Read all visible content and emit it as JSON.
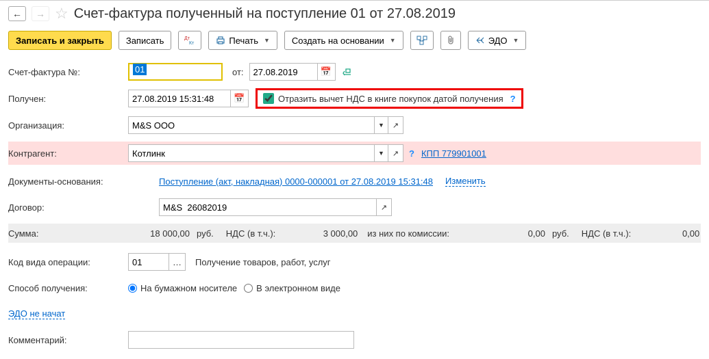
{
  "title": "Счет-фактура полученный на поступление 01 от 27.08.2019",
  "toolbar": {
    "save_close": "Записать и закрыть",
    "save": "Записать",
    "print": "Печать",
    "create_based": "Создать на основании",
    "edo": "ЭДО"
  },
  "labels": {
    "invoice_no": "Счет-фактура №:",
    "from": "от:",
    "received": "Получен:",
    "vat_checkbox": "Отразить вычет НДС в книге покупок датой получения",
    "organization": "Организация:",
    "counterparty": "Контрагент:",
    "docs_base": "Документы-основания:",
    "change": "Изменить",
    "contract": "Договор:",
    "sum": "Сумма:",
    "rub": "руб.",
    "vat_incl": "НДС (в т.ч.):",
    "commission": "из них по комиссии:",
    "op_code": "Код вида операции:",
    "op_code_desc": "Получение товаров, работ, услуг",
    "receive_method": "Способ получения:",
    "paper": "На бумажном носителе",
    "electronic": "В электронном виде",
    "edo_status": "ЭДО не начат",
    "comment": "Комментарий:"
  },
  "values": {
    "invoice_no": "01",
    "invoice_date": "27.08.2019",
    "received_datetime": "27.08.2019 15:31:48",
    "organization": "M&S ООО",
    "counterparty": "Котлинк",
    "kpp": "КПП 779901001",
    "doc_base_link": "Поступление (акт, накладная) 0000-000001 от 27.08.2019 15:31:48",
    "contract": "M&S  26082019",
    "op_code": "01"
  },
  "sums": {
    "total": "18 000,00",
    "vat": "3 000,00",
    "commission": "0,00",
    "commission_vat": "0,00"
  }
}
